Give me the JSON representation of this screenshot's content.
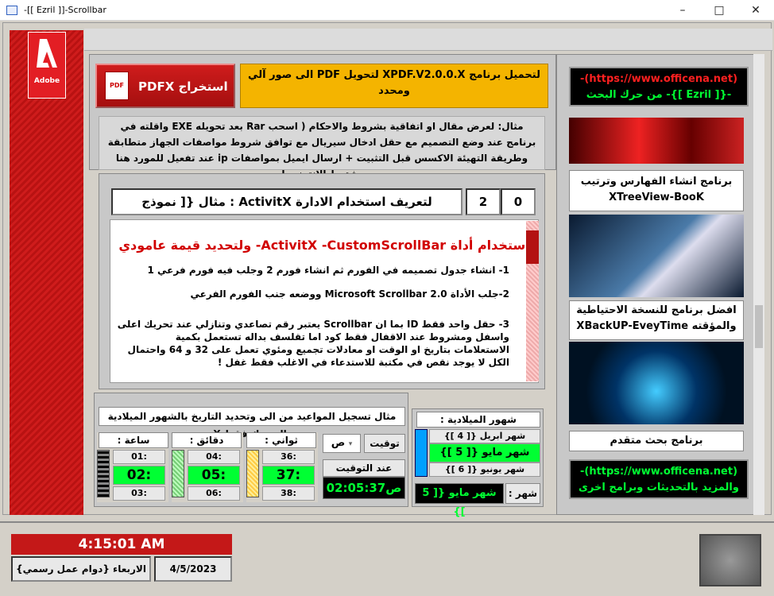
{
  "window": {
    "title": "-[[ Ezril ]]-Scrollbar",
    "min": "–",
    "max": "□",
    "close": "✕"
  },
  "logo": {
    "text": "Adobe"
  },
  "pdf": {
    "button_label": "PDFX استخراج",
    "pdf_tag": "PDF",
    "yellow_text": "لتحميل برنامج XPDF.V2.0.0.X لتحويل PDF الى صور آلي ومحدد"
  },
  "note": "مثال:  لعرض مقال او اتفاقية بشروط والاحكام ( اسحب Rar بعد تحويله EXE واقلته في برنامج  عند وضع التصميم مع حقل ادخال سيريال مع توافق شروط مواصفات الجهاز متطابقة وطريقة التهيئة الاكسس قبل التثبيت + ارسال ايميل بمواصفات ip عند تفعيل للمورد هنا يشترط الانترنت !",
  "main": {
    "header": "لتعريف استخدام الادارة ActivitX : مثال {[ نموذج مستمر]}",
    "num1": "2",
    "num2": "0",
    "heading": "استخدام أداة ActivitX -CustomScrollBar- ولتحديد قيمة عامودي",
    "p1": "1- انشاء جدول تصميمه في الفورم ثم انشاء فورم 2 وجلب فيه فورم فرعي 1",
    "p2": "2-جلب الأداة Microsoft Scrollbar 2.0 ووضعه جنب الفورم الفرعي",
    "p3": "3- حقل واحد فقط ID بما ان Scrollbar يعتبر رقم تصاعدي وتنازلي عند تحريك اعلى واسفل ومشروط عند الاقفال فقط كود اما تقلسف بداله تستعمل بكمية الاستعلامات بتاريخ او الوقت او معادلات تجميع ومئوي  تعمل على 32 و 64 واحتمال الكل لا يوجد نقص في مكتبة للاستدعاء في الاغلب فقط غفل !"
  },
  "timer": {
    "header": "مثال تسجيل المواعيد من الى وتحديد التاريخ بالشهور الميلادية بالتحريك فقط X",
    "hours": {
      "label": "ساعة :",
      "prev": "01:",
      "cur": "02:",
      "next": "03:"
    },
    "minutes": {
      "label": "دقائق :",
      "prev": "04:",
      "cur": "05:",
      "next": "06:"
    },
    "seconds": {
      "label": "ثواني :",
      "prev": "36:",
      "cur": "37:",
      "next": "38:"
    },
    "ampm_label": "توقيت",
    "ampm_value": "ص",
    "time_label": "عند التوقيت المحدد",
    "time_value": "ص02:05:37"
  },
  "months": {
    "header": "شهور الميلادية :",
    "prev": "شهر ابريل {[ 4 ]}",
    "cur": "شهر مايو {[ 5 ]}",
    "next": "شهر يونيو {[ 6 ]}",
    "sel_label": "شهر :",
    "sel_value": "شهر مايو {[ 5 ]}"
  },
  "right": {
    "top_link": "(https://www.officena.net)-",
    "top_sub": "-{[ Ezril ]}- من حرك البحث",
    "card1": "برنامج انشاء الفهارس وترتيب XTreeView-BooK",
    "card2": "افضل برنامج للنسخة الاحتياطية والمؤقته XBackUP-EveyTime",
    "card3": "برنامج بحث متقدم",
    "bottom_link": "(https://www.officena.net)-",
    "bottom_sub": "والمزيد بالتحديثات وبرامج اخرى"
  },
  "footer": {
    "clock": "4:15:01 AM",
    "day": "الاربعاء {دوام عمل رسمي}",
    "date": "4/5/2023"
  }
}
